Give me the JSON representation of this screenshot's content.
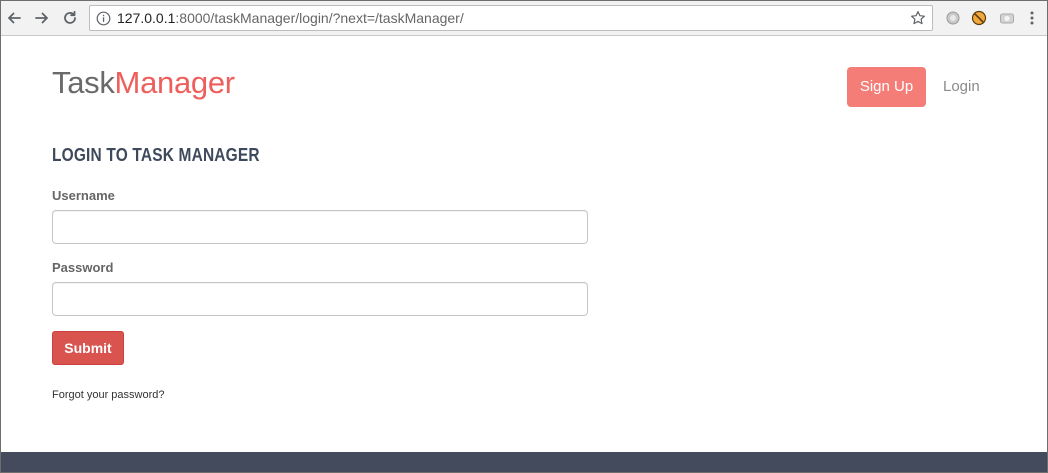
{
  "browser": {
    "url_host": "127.0.0.1",
    "url_rest": ":8000/taskManager/login/?next=/taskManager/",
    "icons": {
      "back": "back-arrow-icon",
      "forward": "forward-arrow-icon",
      "reload": "reload-icon",
      "info": "info-icon",
      "bookmark": "star-icon",
      "menu": "kebab-menu-icon"
    }
  },
  "header": {
    "brand_part1": "Task",
    "brand_part2": "Manager",
    "signup_label": "Sign Up",
    "login_label": "Login"
  },
  "login_form": {
    "heading": "LOGIN TO TASK MANAGER",
    "username_label": "Username",
    "username_value": "",
    "password_label": "Password",
    "password_value": "",
    "submit_label": "Submit",
    "forgot_label": "Forgot your password?"
  },
  "colors": {
    "accent": "#ee5f5b",
    "signup_bg": "#f47d77",
    "submit_bg": "#d9534f",
    "heading": "#3e4a5c",
    "footer": "#434b5c"
  }
}
